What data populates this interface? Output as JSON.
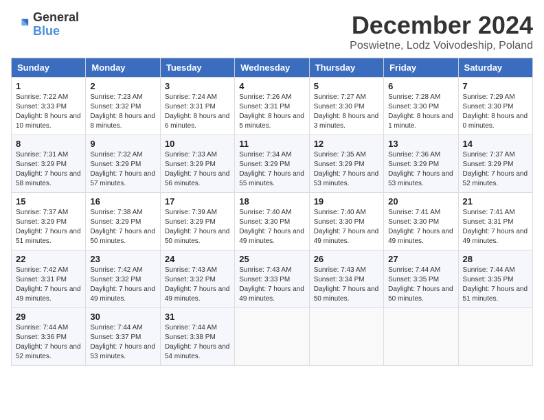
{
  "header": {
    "logo_general": "General",
    "logo_blue": "Blue",
    "month_title": "December 2024",
    "location": "Poswietne, Lodz Voivodeship, Poland"
  },
  "days_of_week": [
    "Sunday",
    "Monday",
    "Tuesday",
    "Wednesday",
    "Thursday",
    "Friday",
    "Saturday"
  ],
  "weeks": [
    [
      {
        "day": "1",
        "sunrise": "7:22 AM",
        "sunset": "3:33 PM",
        "daylight": "8 hours and 10 minutes."
      },
      {
        "day": "2",
        "sunrise": "7:23 AM",
        "sunset": "3:32 PM",
        "daylight": "8 hours and 8 minutes."
      },
      {
        "day": "3",
        "sunrise": "7:24 AM",
        "sunset": "3:31 PM",
        "daylight": "8 hours and 6 minutes."
      },
      {
        "day": "4",
        "sunrise": "7:26 AM",
        "sunset": "3:31 PM",
        "daylight": "8 hours and 5 minutes."
      },
      {
        "day": "5",
        "sunrise": "7:27 AM",
        "sunset": "3:30 PM",
        "daylight": "8 hours and 3 minutes."
      },
      {
        "day": "6",
        "sunrise": "7:28 AM",
        "sunset": "3:30 PM",
        "daylight": "8 hours and 1 minute."
      },
      {
        "day": "7",
        "sunrise": "7:29 AM",
        "sunset": "3:30 PM",
        "daylight": "8 hours and 0 minutes."
      }
    ],
    [
      {
        "day": "8",
        "sunrise": "7:31 AM",
        "sunset": "3:29 PM",
        "daylight": "7 hours and 58 minutes."
      },
      {
        "day": "9",
        "sunrise": "7:32 AM",
        "sunset": "3:29 PM",
        "daylight": "7 hours and 57 minutes."
      },
      {
        "day": "10",
        "sunrise": "7:33 AM",
        "sunset": "3:29 PM",
        "daylight": "7 hours and 56 minutes."
      },
      {
        "day": "11",
        "sunrise": "7:34 AM",
        "sunset": "3:29 PM",
        "daylight": "7 hours and 55 minutes."
      },
      {
        "day": "12",
        "sunrise": "7:35 AM",
        "sunset": "3:29 PM",
        "daylight": "7 hours and 53 minutes."
      },
      {
        "day": "13",
        "sunrise": "7:36 AM",
        "sunset": "3:29 PM",
        "daylight": "7 hours and 53 minutes."
      },
      {
        "day": "14",
        "sunrise": "7:37 AM",
        "sunset": "3:29 PM",
        "daylight": "7 hours and 52 minutes."
      }
    ],
    [
      {
        "day": "15",
        "sunrise": "7:37 AM",
        "sunset": "3:29 PM",
        "daylight": "7 hours and 51 minutes."
      },
      {
        "day": "16",
        "sunrise": "7:38 AM",
        "sunset": "3:29 PM",
        "daylight": "7 hours and 50 minutes."
      },
      {
        "day": "17",
        "sunrise": "7:39 AM",
        "sunset": "3:29 PM",
        "daylight": "7 hours and 50 minutes."
      },
      {
        "day": "18",
        "sunrise": "7:40 AM",
        "sunset": "3:30 PM",
        "daylight": "7 hours and 49 minutes."
      },
      {
        "day": "19",
        "sunrise": "7:40 AM",
        "sunset": "3:30 PM",
        "daylight": "7 hours and 49 minutes."
      },
      {
        "day": "20",
        "sunrise": "7:41 AM",
        "sunset": "3:30 PM",
        "daylight": "7 hours and 49 minutes."
      },
      {
        "day": "21",
        "sunrise": "7:41 AM",
        "sunset": "3:31 PM",
        "daylight": "7 hours and 49 minutes."
      }
    ],
    [
      {
        "day": "22",
        "sunrise": "7:42 AM",
        "sunset": "3:31 PM",
        "daylight": "7 hours and 49 minutes."
      },
      {
        "day": "23",
        "sunrise": "7:42 AM",
        "sunset": "3:32 PM",
        "daylight": "7 hours and 49 minutes."
      },
      {
        "day": "24",
        "sunrise": "7:43 AM",
        "sunset": "3:32 PM",
        "daylight": "7 hours and 49 minutes."
      },
      {
        "day": "25",
        "sunrise": "7:43 AM",
        "sunset": "3:33 PM",
        "daylight": "7 hours and 49 minutes."
      },
      {
        "day": "26",
        "sunrise": "7:43 AM",
        "sunset": "3:34 PM",
        "daylight": "7 hours and 50 minutes."
      },
      {
        "day": "27",
        "sunrise": "7:44 AM",
        "sunset": "3:35 PM",
        "daylight": "7 hours and 50 minutes."
      },
      {
        "day": "28",
        "sunrise": "7:44 AM",
        "sunset": "3:35 PM",
        "daylight": "7 hours and 51 minutes."
      }
    ],
    [
      {
        "day": "29",
        "sunrise": "7:44 AM",
        "sunset": "3:36 PM",
        "daylight": "7 hours and 52 minutes."
      },
      {
        "day": "30",
        "sunrise": "7:44 AM",
        "sunset": "3:37 PM",
        "daylight": "7 hours and 53 minutes."
      },
      {
        "day": "31",
        "sunrise": "7:44 AM",
        "sunset": "3:38 PM",
        "daylight": "7 hours and 54 minutes."
      },
      null,
      null,
      null,
      null
    ]
  ]
}
